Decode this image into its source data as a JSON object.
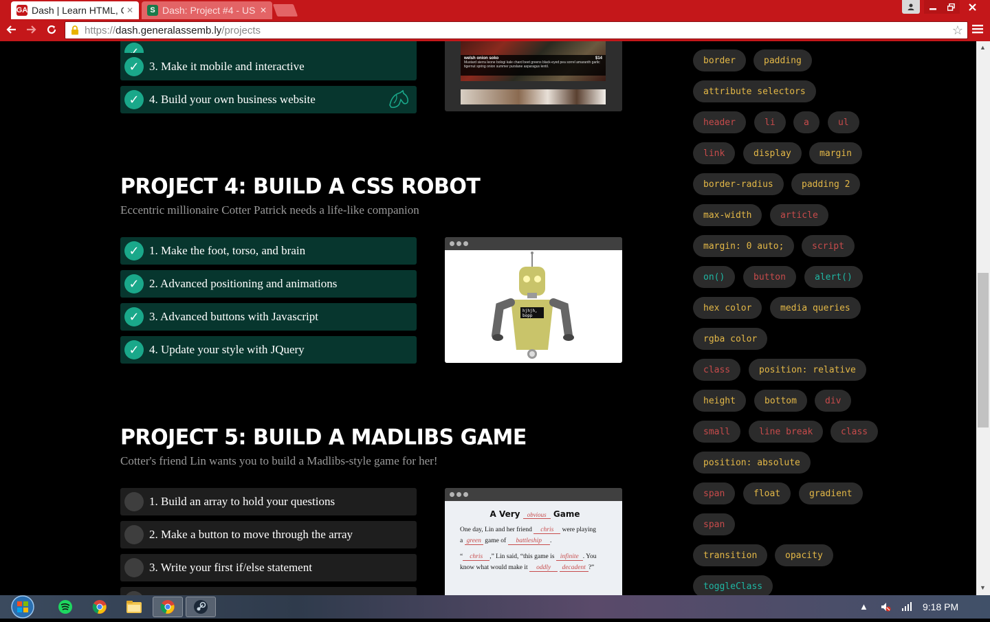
{
  "browser": {
    "tabs": [
      {
        "title": "Dash | Learn HTML, C",
        "favicon": "GA",
        "active": true
      },
      {
        "title": "Dash: Project #4 - US",
        "favicon": "S",
        "active": false
      }
    ],
    "url": {
      "scheme": "https://",
      "host": "dash.generalassemb.ly",
      "path": "/projects"
    }
  },
  "projects": [
    {
      "title": "",
      "description": "",
      "tasks": [
        {
          "label": "3. Make it mobile and interactive",
          "done": true
        },
        {
          "label": "4. Build your own business website",
          "done": true,
          "extra_icon": "horse-head-icon"
        }
      ],
      "preview": {
        "dish": "welsh onion soko",
        "price": "$14",
        "ingredients": "Mustard sierra leone bologi kale chard beet greens black-eyed pea sorrel amaranth garlic tigernut spring onion summer purslane asparagus lentil."
      }
    },
    {
      "title": "PROJECT 4: BUILD A CSS ROBOT",
      "description": "Eccentric millionaire Cotter Patrick needs a life-like companion",
      "tasks": [
        {
          "label": "1. Make the foot, torso, and brain",
          "done": true
        },
        {
          "label": "2. Advanced positioning and animations",
          "done": true
        },
        {
          "label": "3. Advanced buttons with Javascript",
          "done": true
        },
        {
          "label": "4. Update your style with JQuery",
          "done": true
        }
      ],
      "preview": {
        "screen_text_line1": "hjhjh,",
        "screen_text_line2": "bopp"
      }
    },
    {
      "title": "PROJECT 5: BUILD A MADLIBS GAME",
      "description": "Cotter's friend Lin wants you to build a Madlibs-style game for her!",
      "tasks": [
        {
          "label": "1. Build an array to hold your questions",
          "done": false
        },
        {
          "label": "2. Make a button to move through the array",
          "done": false
        },
        {
          "label": "3. Write your first if/else statement",
          "done": false
        }
      ],
      "preview": {
        "title_pre": "A Very",
        "title_word": "obvious",
        "title_post": "Game",
        "line1_pre": "One day, Lin and her friend",
        "word_chris": "chris",
        "line1_post": "were playing",
        "line2_pre": "a",
        "word_green": "green",
        "line2_mid": "game of",
        "word_battleship": "battleship",
        "line2_post": ".",
        "line3_open": "“",
        "word_chris2": "chris",
        "line3_mid": ",” Lin said, “this game is",
        "word_infinite": "infinite",
        "line3_post": ". You",
        "line4_pre": "know what would make it",
        "word_oddly": "oddly",
        "word_decadent": "decadent",
        "line4_post": "?”"
      }
    }
  ],
  "tags": [
    {
      "label": "border",
      "color": "yellow"
    },
    {
      "label": "padding",
      "color": "yellow"
    },
    {
      "label": "attribute selectors",
      "color": "yellow"
    },
    {
      "label": "header",
      "color": "red"
    },
    {
      "label": "li",
      "color": "red"
    },
    {
      "label": "a",
      "color": "red"
    },
    {
      "label": "ul",
      "color": "red"
    },
    {
      "label": "link",
      "color": "red"
    },
    {
      "label": "display",
      "color": "yellow"
    },
    {
      "label": "margin",
      "color": "yellow"
    },
    {
      "label": "border-radius",
      "color": "yellow"
    },
    {
      "label": "padding 2",
      "color": "yellow"
    },
    {
      "label": "max-width",
      "color": "yellow"
    },
    {
      "label": "article",
      "color": "red"
    },
    {
      "label": "margin: 0 auto;",
      "color": "yellow"
    },
    {
      "label": "script",
      "color": "red"
    },
    {
      "label": "on()",
      "color": "cyan"
    },
    {
      "label": "button",
      "color": "red"
    },
    {
      "label": "alert()",
      "color": "cyan"
    },
    {
      "label": "hex color",
      "color": "yellow"
    },
    {
      "label": "media queries",
      "color": "yellow"
    },
    {
      "label": "rgba color",
      "color": "yellow"
    },
    {
      "label": "class",
      "color": "red"
    },
    {
      "label": "position: relative",
      "color": "yellow"
    },
    {
      "label": "height",
      "color": "yellow"
    },
    {
      "label": "bottom",
      "color": "yellow"
    },
    {
      "label": "div",
      "color": "red"
    },
    {
      "label": "small",
      "color": "red"
    },
    {
      "label": "line break",
      "color": "red"
    },
    {
      "label": "class",
      "color": "red"
    },
    {
      "label": "position: absolute",
      "color": "yellow"
    },
    {
      "label": "span",
      "color": "red"
    },
    {
      "label": "float",
      "color": "yellow"
    },
    {
      "label": "gradient",
      "color": "yellow"
    },
    {
      "label": "span",
      "color": "red"
    },
    {
      "label": "transition",
      "color": "yellow"
    },
    {
      "label": "opacity",
      "color": "yellow"
    },
    {
      "label": "toggleClass",
      "color": "cyan"
    }
  ],
  "taskbar": {
    "items": [
      "start-orb",
      "spotify",
      "chrome-pinned",
      "file-explorer",
      "chrome-active",
      "steam"
    ],
    "clock": "9:18 PM"
  },
  "colors": {
    "brand_red": "#c4171a",
    "done_task_bg": "#07362e",
    "check_teal": "#1aa88a",
    "tag_yellow": "#e4b847",
    "tag_red": "#c74b4b",
    "tag_cyan": "#1fb6a3"
  }
}
